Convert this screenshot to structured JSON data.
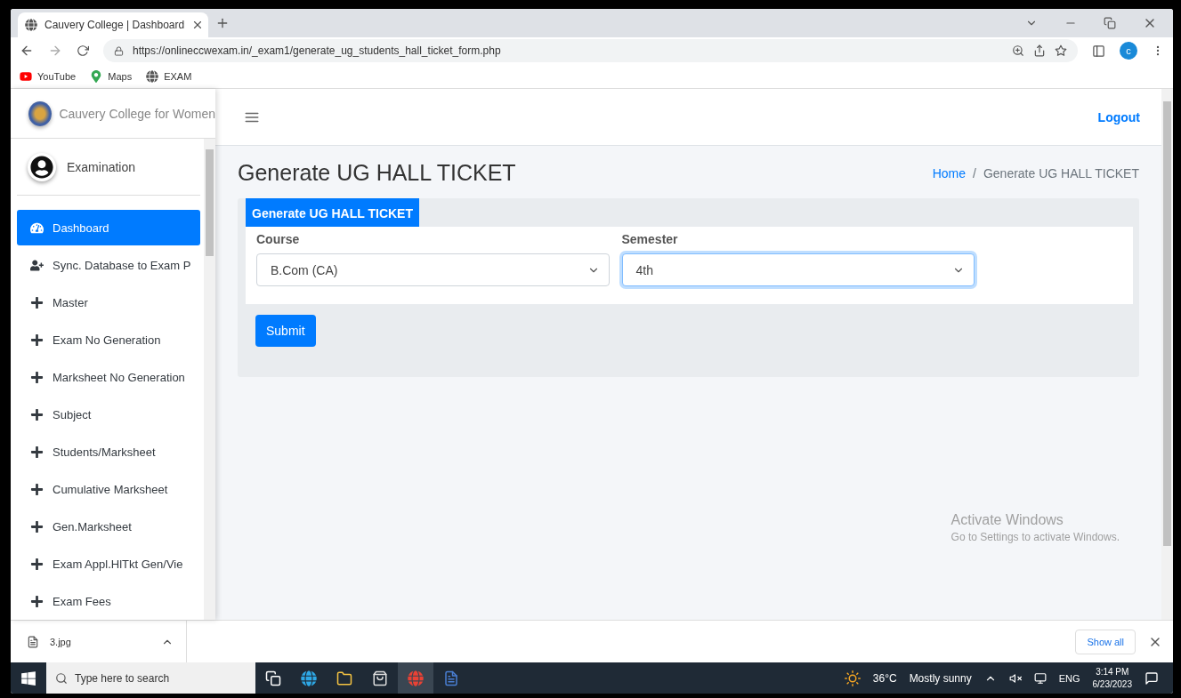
{
  "browser": {
    "tabs": [
      {
        "title": "Cauvery College | Dashboard",
        "selected": true
      }
    ],
    "url": "https://onlineccwexam.in/_exam1/generate_ug_students_hall_ticket_form.php",
    "profile": "c",
    "bookmarks": [
      {
        "label": "YouTube",
        "kind": "youtube"
      },
      {
        "label": "Maps",
        "kind": "maps"
      },
      {
        "label": "EXAM",
        "kind": "globe"
      }
    ]
  },
  "sidebar": {
    "brand": "Cauvery College for Women",
    "user": "Examination",
    "items": [
      {
        "label": "Dashboard",
        "kind": "gauge",
        "selected": true
      },
      {
        "label": "Sync. Database to Exam P",
        "kind": "user-plus",
        "selected": false
      },
      {
        "label": "Master",
        "kind": "plus",
        "selected": false
      },
      {
        "label": "Exam No Generation",
        "kind": "plus",
        "selected": false
      },
      {
        "label": "Marksheet No Generation",
        "kind": "plus",
        "selected": false
      },
      {
        "label": "Subject",
        "kind": "plus",
        "selected": false
      },
      {
        "label": "Students/Marksheet",
        "kind": "plus",
        "selected": false
      },
      {
        "label": "Cumulative Marksheet",
        "kind": "plus",
        "selected": false
      },
      {
        "label": "Gen.Marksheet",
        "kind": "plus",
        "selected": false
      },
      {
        "label": "Exam Appl.HlTkt Gen/Vie",
        "kind": "plus",
        "selected": false
      },
      {
        "label": "Exam Fees",
        "kind": "plus",
        "selected": false
      }
    ]
  },
  "topbar": {
    "logout": "Logout"
  },
  "page": {
    "title": "Generate UG HALL TICKET",
    "breadcrumb_separator": "/",
    "breadcrumb": [
      {
        "label": "Home",
        "kind": "link"
      },
      {
        "label": "Generate UG HALL TICKET",
        "kind": "current"
      }
    ],
    "card_title": "Generate UG HALL TICKET",
    "fields": [
      {
        "label": "Course",
        "value": "B.Com (CA)",
        "focused": false
      },
      {
        "label": "Semester",
        "value": "4th",
        "focused": true
      }
    ],
    "submit": "Submit"
  },
  "watermark": {
    "title": "Activate Windows",
    "subtitle": "Go to Settings to activate Windows."
  },
  "downloads": {
    "file": "3.jpg",
    "show_all": "Show all"
  },
  "taskbar": {
    "search_placeholder": "Type here to search",
    "temperature": "36°C",
    "weather": "Mostly sunny",
    "language": "ENG",
    "time": "3:14 PM",
    "date": "6/23/2023"
  }
}
